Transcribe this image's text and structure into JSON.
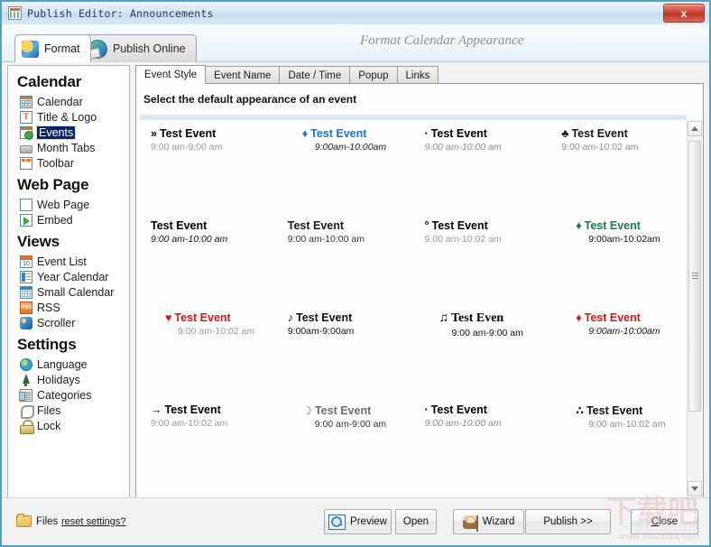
{
  "window": {
    "title": "Publish Editor: Announcements",
    "close_label": "x"
  },
  "app_tabs": [
    {
      "label": "Format",
      "icon": "format-icon",
      "active": true
    },
    {
      "label": "Publish Online",
      "icon": "globe-icon",
      "active": false
    }
  ],
  "header": {
    "title": "Format Calendar Appearance"
  },
  "sidebar": {
    "sections": [
      {
        "title": "Calendar",
        "items": [
          {
            "label": "Calendar",
            "icon": "calendar-icon",
            "selected": false
          },
          {
            "label": "Title & Logo",
            "icon": "title-logo-icon",
            "selected": false
          },
          {
            "label": "Events",
            "icon": "events-icon",
            "selected": true
          },
          {
            "label": "Month Tabs",
            "icon": "month-tabs-icon",
            "selected": false
          },
          {
            "label": "Toolbar",
            "icon": "toolbar-icon",
            "selected": false
          }
        ]
      },
      {
        "title": "Web Page",
        "items": [
          {
            "label": "Web Page",
            "icon": "web-page-icon",
            "selected": false
          },
          {
            "label": "Embed",
            "icon": "embed-icon",
            "selected": false
          }
        ]
      },
      {
        "title": "Views",
        "items": [
          {
            "label": "Event List",
            "icon": "event-list-icon",
            "selected": false
          },
          {
            "label": "Year Calendar",
            "icon": "year-calendar-icon",
            "selected": false
          },
          {
            "label": "Small Calendar",
            "icon": "small-calendar-icon",
            "selected": false
          },
          {
            "label": "RSS",
            "icon": "rss-icon",
            "selected": false
          },
          {
            "label": "Scroller",
            "icon": "scroller-icon",
            "selected": false
          }
        ]
      },
      {
        "title": "Settings",
        "items": [
          {
            "label": "Language",
            "icon": "language-globe-icon",
            "selected": false
          },
          {
            "label": "Holidays",
            "icon": "holidays-tree-icon",
            "selected": false
          },
          {
            "label": "Categories",
            "icon": "categories-icon",
            "selected": false
          },
          {
            "label": "Files",
            "icon": "paperclip-icon",
            "selected": false
          },
          {
            "label": "Lock",
            "icon": "lock-icon",
            "selected": false
          }
        ]
      }
    ]
  },
  "panel": {
    "tabs": [
      {
        "label": "Event Style",
        "active": true
      },
      {
        "label": "Event Name",
        "active": false
      },
      {
        "label": "Date / Time",
        "active": false
      },
      {
        "label": "Popup",
        "active": false
      },
      {
        "label": "Links",
        "active": false
      }
    ],
    "heading": "Select the default appearance of an event",
    "styles": [
      {
        "bullet": "»",
        "title": "Test Event",
        "time": "9:00 am-9:00 am",
        "title_color": "#000000",
        "time_color": "#9a9a9a",
        "title_style": "normal",
        "time_style": "normal",
        "align": "left",
        "font": "sans"
      },
      {
        "bullet": "♦",
        "title": "Test Event",
        "time": "9:00am-10:00am",
        "title_color": "#1779d4",
        "time_color": "#222222",
        "title_style": "normal",
        "time_style": "italic",
        "align": "center",
        "font": "sans"
      },
      {
        "bullet": "·",
        "title": "Test Event",
        "time": "9:00 am-10:00 am",
        "title_color": "#000000",
        "time_color": "#8d8d8d",
        "title_style": "normal",
        "time_style": "italic",
        "align": "left",
        "font": "sans"
      },
      {
        "bullet": "♣",
        "title": "Test Event",
        "time": "9:00 am-10:02 am",
        "title_color": "#1a1a1a",
        "time_color": "#8d8d8d",
        "title_style": "normal",
        "time_style": "normal",
        "align": "left",
        "font": "sans"
      },
      {
        "bullet": "",
        "title": "Test Event",
        "time": "9:00 am-10:00 am",
        "title_color": "#000000",
        "time_color": "#111111",
        "title_style": "normal",
        "time_style": "italic",
        "align": "left",
        "font": "sans"
      },
      {
        "bullet": "",
        "title": "Test Event",
        "time": "9:00 am-10:00 am",
        "title_color": "#1a1a1a",
        "time_color": "#333333",
        "title_style": "normal",
        "time_style": "normal",
        "align": "left",
        "font": "sans"
      },
      {
        "bullet": "°",
        "title": "Test Event",
        "time": "9:00 am-10:02 am",
        "title_color": "#000000",
        "time_color": "#9a9a9a",
        "title_style": "normal",
        "time_style": "normal",
        "align": "left",
        "font": "sans"
      },
      {
        "bullet": "♦",
        "title": "Test Event",
        "time": "9:00am-10:02am",
        "title_color": "#13803f",
        "time_color": "#111111",
        "title_style": "normal",
        "time_style": "normal",
        "align": "center",
        "font": "sans"
      },
      {
        "bullet": "♥",
        "title": "Test Event",
        "time": "9:00 am-10:02 am",
        "title_color": "#d31b1b",
        "time_color": "#9a9a9a",
        "title_style": "normal",
        "time_style": "normal",
        "align": "center",
        "font": "sans"
      },
      {
        "bullet": "♪",
        "title": "Test Event",
        "time": "9:00am-9:00am",
        "title_color": "#111111",
        "time_color": "#111111",
        "title_style": "normal",
        "time_style": "normal",
        "align": "left",
        "font": "sans"
      },
      {
        "bullet": "♫",
        "title": "Test Even",
        "time": "9:00 am-9:00 am",
        "title_color": "#000000",
        "time_color": "#111111",
        "title_style": "normal",
        "time_style": "normal",
        "align": "center",
        "font": "serif"
      },
      {
        "bullet": "♦",
        "title": "Test Event",
        "time": "9:00am-10:00am",
        "title_color": "#d31b1b",
        "time_color": "#111111",
        "title_style": "normal",
        "time_style": "italic",
        "align": "center",
        "font": "sans"
      },
      {
        "bullet": "→",
        "title": "Test Event",
        "time": "9:00 am-10:02 am",
        "title_color": "#000000",
        "time_color": "#9a9a9a",
        "title_style": "normal",
        "time_style": "normal",
        "align": "left",
        "font": "sans"
      },
      {
        "bullet": "☽",
        "title": "Test Event",
        "time": "9:00 am-9:00 am",
        "title_color": "#6e6e6e",
        "time_color": "#333333",
        "title_style": "normal",
        "time_style": "normal",
        "align": "center",
        "font": "sans"
      },
      {
        "bullet": "·",
        "title": "Test Event",
        "time": "9:00 am-10:00 am",
        "title_color": "#000000",
        "time_color": "#8d8d8d",
        "title_style": "normal",
        "time_style": "italic",
        "align": "left",
        "font": "sans"
      },
      {
        "bullet": "∴",
        "title": "Test Event",
        "time": "9:00 am-10:02 am",
        "title_color": "#111111",
        "time_color": "#8d8d8d",
        "title_style": "normal",
        "time_style": "normal",
        "align": "center",
        "font": "sans"
      }
    ]
  },
  "footer": {
    "files_label": "Files",
    "reset_label": "reset settings?",
    "buttons": [
      {
        "label": "Preview",
        "icon": "preview-icon"
      },
      {
        "label": "Open",
        "icon": null
      },
      {
        "label": "Wizard",
        "icon": "wizard-icon"
      },
      {
        "label": "Publish >>",
        "icon": null
      },
      {
        "label": "Close",
        "icon": null
      }
    ]
  },
  "watermark": {
    "url": "www.xiazaiba.com",
    "glyph": "下载吧"
  },
  "colors": {
    "title_bar": "#d6e7f6",
    "accent_blue": "#4fa3c7",
    "selection": "#0a246a",
    "band": "#dbeaf7"
  }
}
